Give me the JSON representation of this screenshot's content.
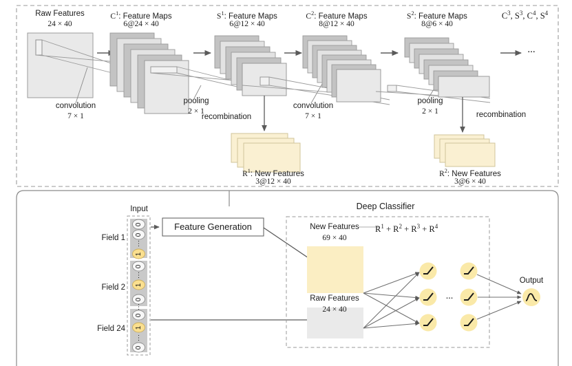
{
  "title": "CNN feature generation and deep classifier architecture diagram",
  "top_section": {
    "stages": [
      {
        "id": "raw",
        "title": "Raw Features",
        "dims": "24 × 40"
      },
      {
        "id": "c1",
        "title_html": "C<sup>1</sup>: Feature Maps",
        "title": "C1: Feature Maps",
        "dims": "6@24 × 40"
      },
      {
        "id": "s1",
        "title_html": "S<sup>1</sup>: Feature Maps",
        "title": "S1: Feature Maps",
        "dims": "6@12 × 40"
      },
      {
        "id": "c2",
        "title_html": "C<sup>2</sup>: Feature Maps",
        "title": "C2: Feature Maps",
        "dims": "8@12 × 40"
      },
      {
        "id": "s2",
        "title_html": "S<sup>2</sup>: Feature Maps",
        "title": "S2: Feature Maps",
        "dims": "8@6 × 40"
      },
      {
        "id": "more",
        "title_html": "C<sup>3</sup>, S<sup>3</sup>, C<sup>4</sup>, S<sup>4</sup>",
        "title": "C3, S3, C4, S4",
        "dims": ""
      }
    ],
    "op_labels": [
      {
        "id": "conv1",
        "name": "convolution",
        "param": "7 × 1"
      },
      {
        "id": "pool1",
        "name": "pooling",
        "param": "2 × 1"
      },
      {
        "id": "conv2",
        "name": "convolution",
        "param": "7 × 1"
      },
      {
        "id": "pool2",
        "name": "pooling",
        "param": "2 × 1"
      }
    ],
    "recombination_labels": [
      "recombination",
      "recombination"
    ],
    "new_feature_stacks": [
      {
        "id": "r1",
        "title_html": "R<sup>1</sup>: New Features",
        "title": "R1: New Features",
        "dims": "3@12 × 40"
      },
      {
        "id": "r2",
        "title_html": "R<sup>2</sup>: New Features",
        "title": "R2: New Features",
        "dims": "3@6 × 40"
      }
    ],
    "ellipsis": "..."
  },
  "bottom_section": {
    "input_label": "Input",
    "fields": [
      "Field 1",
      "Field 2",
      "Field 24"
    ],
    "cell_values": {
      "zero": "0",
      "one": "1",
      "dots": "⋮"
    },
    "feature_generation_label": "Feature Generation",
    "deep_classifier_label": "Deep Classifier",
    "new_features": {
      "title": "New Features",
      "dims": "69 × 40"
    },
    "raw_features": {
      "title": "Raw Features",
      "dims": "24 × 40"
    },
    "sum_label_html": "R<sup>1</sup> + R<sup>2</sup> + R<sup>3</sup> + R<sup>4</sup>",
    "sum_label": "R1 + R2 + R3 + R4",
    "hidden_ellipsis": "...",
    "output_label": "Output",
    "neuron_activation": "relu-glyph",
    "output_activation": "sigmoid-glyph"
  },
  "colors": {
    "map_dark": "#c3c3c3",
    "map_light": "#e3e3e3",
    "raw_box": "#e9e9e9",
    "cream": "#faf0d2",
    "cream_border": "#d8cda2",
    "yellow_node": "#fae9a8",
    "yellow_block": "#fbeec3",
    "stroke": "#8a8a8a",
    "dark_stroke": "#555555",
    "dashed": "#9a9a9a",
    "text": "#1a1a1a"
  }
}
